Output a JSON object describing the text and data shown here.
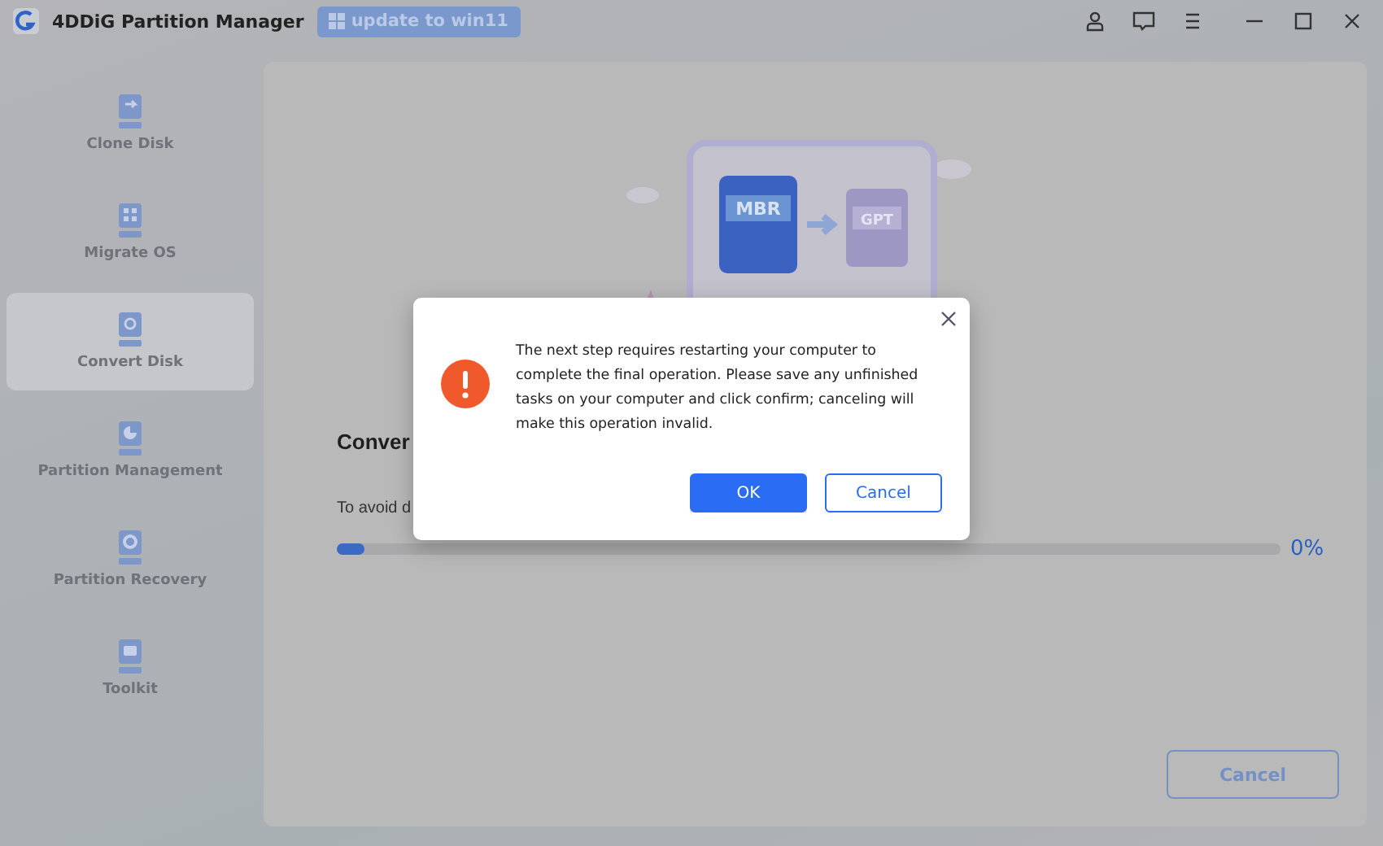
{
  "window": {
    "title": "4DDiG Partition Manager",
    "update_button": "update to win11"
  },
  "sidebar": {
    "items": [
      {
        "label": "Clone Disk",
        "kind": "clone",
        "selected": false
      },
      {
        "label": "Migrate OS",
        "kind": "grid",
        "selected": false
      },
      {
        "label": "Convert Disk",
        "kind": "convert",
        "selected": true
      },
      {
        "label": "Partition Management",
        "kind": "pie",
        "selected": false
      },
      {
        "label": "Partition Recovery",
        "kind": "ring",
        "selected": false
      },
      {
        "label": "Toolkit",
        "kind": "kit",
        "selected": false
      }
    ]
  },
  "main": {
    "illustration": {
      "from_label": "MBR",
      "to_label": "GPT"
    },
    "heading": "Conver",
    "note": "To avoid d",
    "progress": {
      "level": 0.03,
      "reading": "0%"
    },
    "cancel_button": "Cancel"
  },
  "dialog": {
    "message": "The next step requires restarting your computer to complete the final operation. Please save any unfinished tasks on your computer and click confirm; canceling will make this operation invalid.",
    "ok_button": "OK",
    "cancel_button": "Cancel"
  }
}
